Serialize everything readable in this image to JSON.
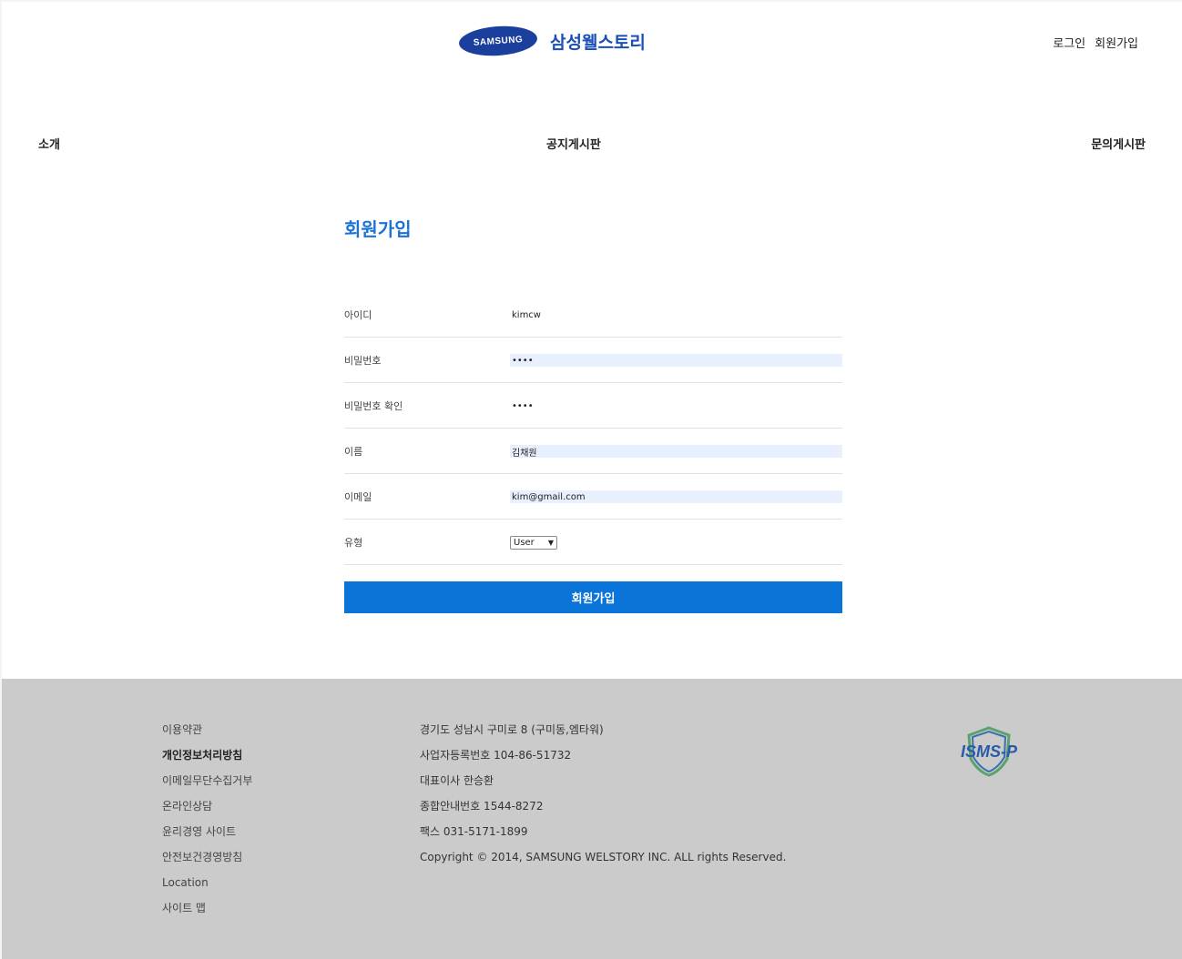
{
  "header": {
    "logo_text": "SAMSUNG",
    "brand_name": "삼성웰스토리",
    "login_label": "로그인",
    "signup_label": "회원가입"
  },
  "nav": {
    "intro": "소개",
    "notice": "공지게시판",
    "inquiry": "문의게시판"
  },
  "form": {
    "title": "회원가입",
    "fields": [
      {
        "label": "아이디",
        "value": "kimcw"
      },
      {
        "label": "비밀번호",
        "value": "••••"
      },
      {
        "label": "비밀번호 확인",
        "value": "••••"
      },
      {
        "label": "이름",
        "value": "김채원"
      },
      {
        "label": "이메일",
        "value": "kim@gmail.com"
      },
      {
        "label": "유형",
        "value": "User"
      }
    ],
    "submit_label": "회원가입"
  },
  "footer": {
    "links": [
      "이용약관",
      "개인정보처리방침",
      "이메일무단수집거부",
      "온라인상담",
      "윤리경영 사이트",
      "안전보건경영방침",
      "Location",
      "사이트 맵"
    ],
    "info": [
      "경기도 성남시 구미로 8 (구미동,엠타워)",
      "사업자등록번호 104-86-51732",
      "대표이사 한승환",
      "종합안내번호 1544-8272",
      "팩스 031-5171-1899",
      "Copyright © 2014, SAMSUNG WELSTORY INC. ALL rights Reserved."
    ],
    "badge_text": "ISMS-P"
  },
  "colors": {
    "accent": "#0a74d9",
    "title": "#1b73d4",
    "brand": "#1a3f9c",
    "footer_bg": "#cbcbcb",
    "autofill_bg": "#e8f0fe"
  }
}
